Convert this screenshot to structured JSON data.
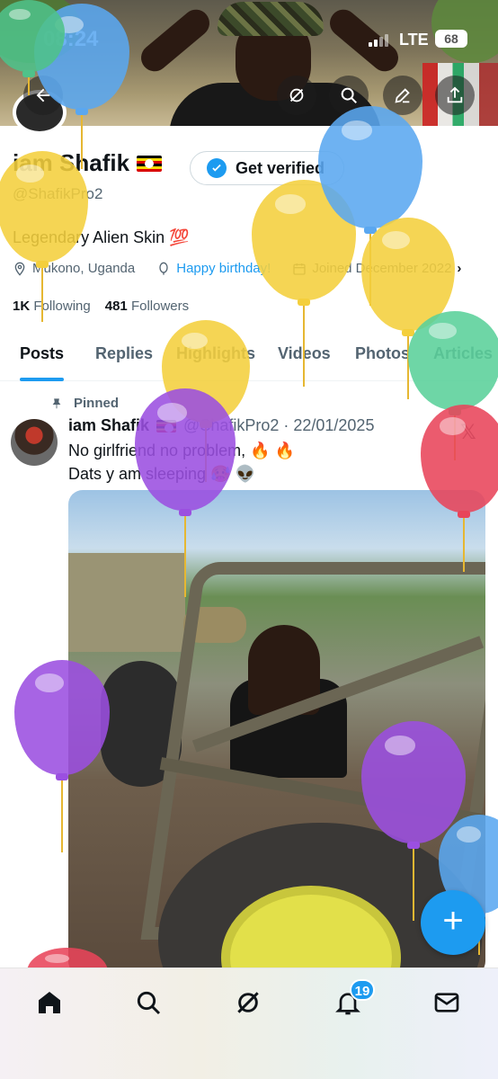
{
  "status_bar": {
    "time": "08:24",
    "network": "LTE",
    "battery": "68"
  },
  "header": {
    "back_icon": "arrow-left-icon",
    "actions": [
      "grok-icon",
      "search-icon",
      "edit-icon",
      "share-icon"
    ]
  },
  "profile": {
    "name": "iam Shafik",
    "flag": "uganda-flag",
    "verify_label": "Get verified",
    "handle": "@ShafikPro2",
    "bio": "Legendary Alien Skin 💯",
    "location": "Mukono, Uganda",
    "birthday": "Happy birthday!",
    "joined": "Joined December 2022",
    "following_count": "1K",
    "following_label": "Following",
    "followers_count": "481",
    "followers_label": "Followers"
  },
  "tabs": [
    {
      "label": "Posts",
      "active": true
    },
    {
      "label": "Replies"
    },
    {
      "label": "Highlights"
    },
    {
      "label": "Videos"
    },
    {
      "label": "Photos"
    },
    {
      "label": "Articles"
    }
  ],
  "post": {
    "pinned_label": "Pinned",
    "author_name": "iam Shafik",
    "author_meta": "@ShafikPro2 · 22/01/2025",
    "line1": "No girlfriend no problem, 🔥 🔥",
    "line2": "Dats y am sleeping 🥵 👽"
  },
  "fab_label": "+",
  "bottom_nav": {
    "items": [
      "home-icon",
      "search-icon",
      "grok-icon",
      "notifications-icon",
      "messages-icon"
    ],
    "notification_count": "19"
  },
  "colors": {
    "accent": "#1d9bf0",
    "text": "#0f1419",
    "muted": "#536471"
  }
}
